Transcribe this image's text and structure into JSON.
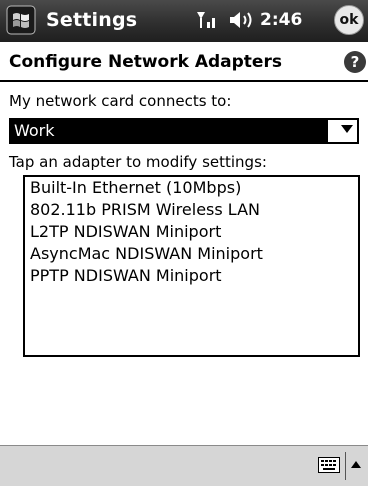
{
  "titlebar": {
    "app_title": "Settings",
    "time": "2:46",
    "ok_label": "ok",
    "start_icon": "windows-flag-icon",
    "signal_icon": "signal-icon",
    "volume_icon": "speaker-icon"
  },
  "page": {
    "title": "Configure Network Adapters",
    "help_label": "?",
    "connects_label": "My network card connects to:",
    "connects_value": "Work",
    "adapter_label": "Tap an adapter to modify settings:"
  },
  "adapters": [
    "Built-In Ethernet (10Mbps)",
    "802.11b PRISM Wireless LAN",
    "L2TP NDISWAN Miniport",
    "AsyncMac NDISWAN Miniport",
    "PPTP NDISWAN Miniport"
  ],
  "bottom_bar": {
    "keyboard_icon": "keyboard-icon",
    "sip_arrow_icon": "sip-up-arrow-icon"
  },
  "colors": {
    "titlebar": "#2f2f2f",
    "selection": "#000000",
    "bottom_bar": "#d6d6d6"
  }
}
